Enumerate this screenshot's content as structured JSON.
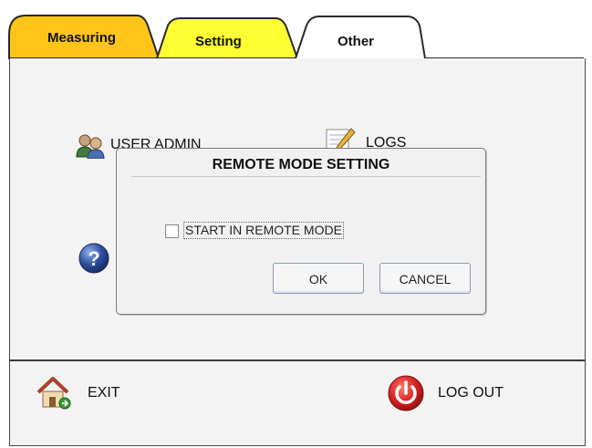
{
  "tabs": [
    {
      "label": "Measuring",
      "color": "#ffc418"
    },
    {
      "label": "Setting",
      "color": "#ffff33"
    },
    {
      "label": "Other",
      "color": "#ffffff",
      "active": true
    }
  ],
  "menu": {
    "user_admin": {
      "label": "USER ADMIN",
      "icon": "users-icon"
    },
    "logs": {
      "label": "LOGS",
      "icon": "notepad-pencil-icon"
    },
    "help": {
      "icon": "help-question-icon"
    }
  },
  "dialog": {
    "title": "REMOTE MODE SETTING",
    "checkbox_label": "START IN REMOTE MODE",
    "checkbox_checked": false,
    "ok_label": "OK",
    "cancel_label": "CANCEL"
  },
  "bottom": {
    "exit_label": "EXIT",
    "exit_icon": "home-icon",
    "logout_label": "LOG OUT",
    "logout_icon": "power-icon"
  },
  "colors": {
    "panel_background": "#f3f3f3",
    "power_red": "#d42020",
    "help_blue": "#2e4fa0"
  }
}
